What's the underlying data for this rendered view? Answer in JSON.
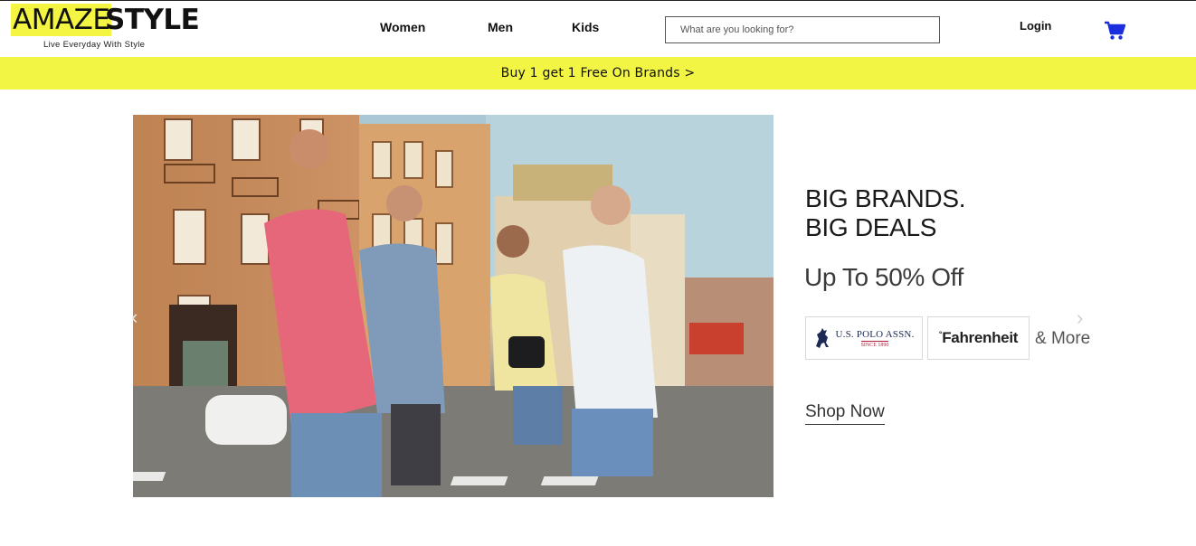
{
  "header": {
    "logo": {
      "part1": "AMAZE",
      "part2": "STYLE",
      "tagline": "Live Everyday With Style"
    },
    "nav": [
      {
        "label": "Women"
      },
      {
        "label": "Men"
      },
      {
        "label": "Kids"
      }
    ],
    "search": {
      "placeholder": "What are you looking for?",
      "value": ""
    },
    "login_label": "Login",
    "icons": {
      "cart": "shopping-cart-icon"
    }
  },
  "promo": {
    "text": "Buy 1 get 1 Free On Brands >"
  },
  "hero": {
    "headline_line1": "BIG BRANDS.",
    "headline_line2": "BIG DEALS",
    "offer": "Up To 50% Off",
    "brands": [
      {
        "name": "U.S. POLO ASSN.",
        "since": "SINCE 1890"
      },
      {
        "name": "Fahrenheit"
      }
    ],
    "more_label": "& More",
    "cta_label": "Shop Now",
    "arrows": {
      "prev": "‹",
      "next": "›"
    }
  },
  "colors": {
    "accent_yellow": "#f3f544",
    "cart_blue": "#1a2ee0",
    "text_dark": "#111111"
  }
}
